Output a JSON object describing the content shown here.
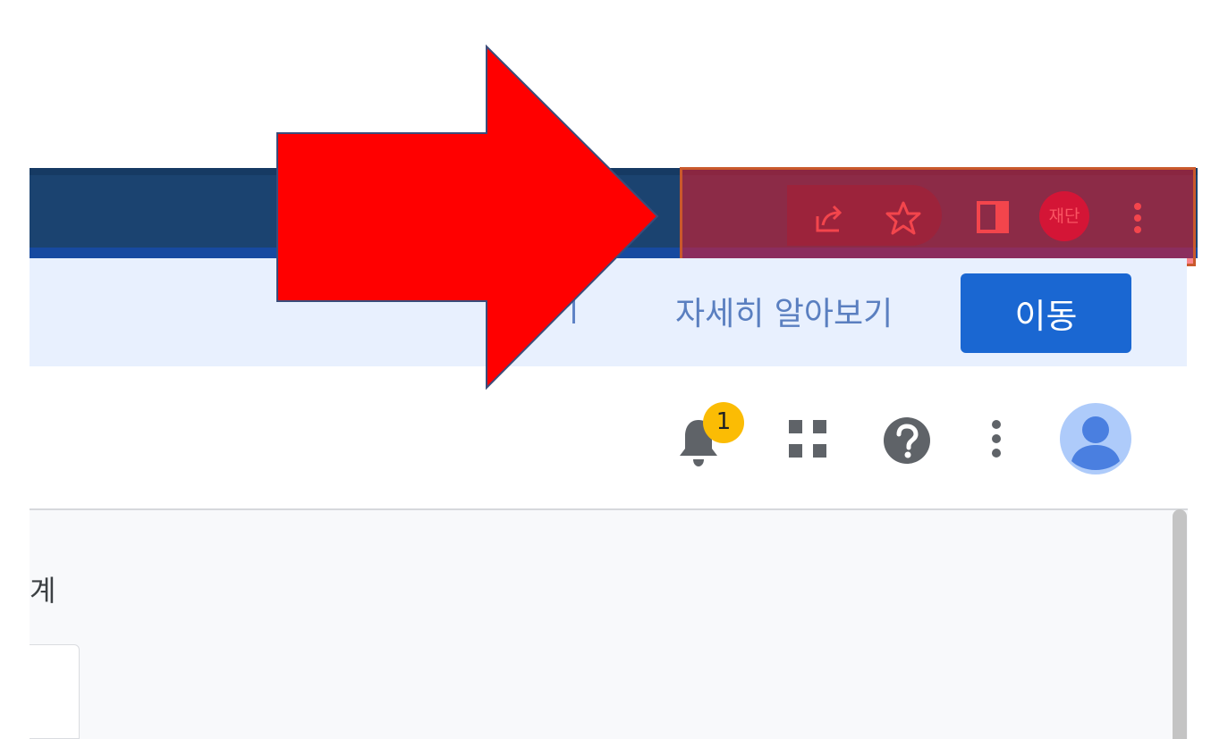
{
  "browser_toolbar": {
    "profile_label": "재단",
    "icons": [
      "share-icon",
      "star-icon",
      "side-panel-icon",
      "more-vert-icon"
    ]
  },
  "banner": {
    "learn_more_label": "자세히 알아보기",
    "go_button_label": "이동"
  },
  "app_header": {
    "notification_count": "1",
    "icons": [
      "bell-icon",
      "apps-grid-icon",
      "help-icon",
      "more-vert-icon",
      "account-avatar-icon"
    ]
  },
  "content": {
    "partial_text": "계"
  },
  "colors": {
    "chrome_bar": "#1b4370",
    "highlight": "#f61622",
    "banner_bg": "#e8f0fe",
    "primary_button": "#1a67d2",
    "badge": "#fbbc04",
    "arrow": "#ff0000"
  }
}
